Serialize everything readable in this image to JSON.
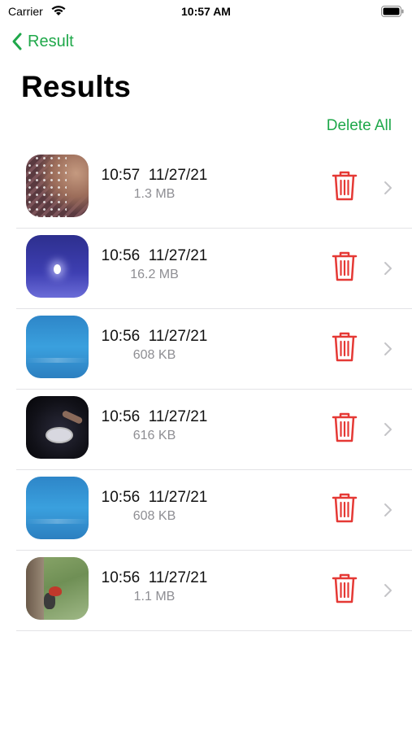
{
  "status_bar": {
    "carrier": "Carrier",
    "time": "10:57 AM"
  },
  "nav": {
    "back_label": "Result"
  },
  "title": "Results",
  "delete_all_label": "Delete All",
  "colors": {
    "accent": "#1fa84a",
    "delete": "#e53935",
    "secondary_text": "#8e8e93"
  },
  "items": [
    {
      "date": "10:57  11/27/21",
      "size": "1.3 MB"
    },
    {
      "date": "10:56  11/27/21",
      "size": "16.2 MB"
    },
    {
      "date": "10:56  11/27/21",
      "size": "608 KB"
    },
    {
      "date": "10:56  11/27/21",
      "size": "616 KB"
    },
    {
      "date": "10:56  11/27/21",
      "size": "608 KB"
    },
    {
      "date": "10:56  11/27/21",
      "size": "1.1 MB"
    }
  ],
  "icons": {
    "row_delete": "trash-icon",
    "row_open": "chevron-right-icon",
    "back": "chevron-left-icon"
  }
}
